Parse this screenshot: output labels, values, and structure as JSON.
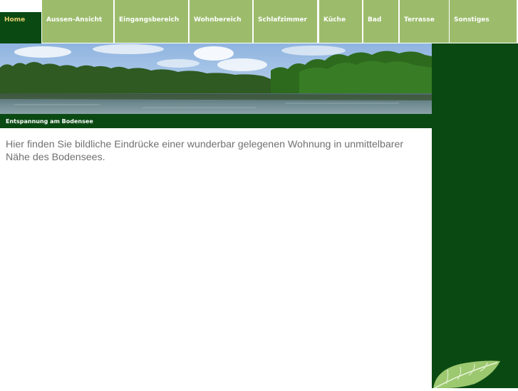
{
  "nav": {
    "items": [
      {
        "label": "Home"
      },
      {
        "label": "Aussen-Ansicht"
      },
      {
        "label": "Eingangsbereich"
      },
      {
        "label": "Wohnbereich"
      },
      {
        "label": "Schlafzimmer"
      },
      {
        "label": "Küche"
      },
      {
        "label": "Bad"
      },
      {
        "label": "Terrasse"
      },
      {
        "label": "Sonstiges"
      }
    ],
    "active": "Home"
  },
  "banner": {
    "caption": "Entspannung am Bodensee"
  },
  "main": {
    "text": "Hier finden Sie bildliche Eindrücke einer wunderbar gelegenen Wohnung in unmittelbarer Nähe des Bodensees."
  },
  "colors": {
    "nav_green": "#9cbc6c",
    "dark_green": "#0a4a12",
    "active_text": "#e8d070",
    "body_text": "#707070"
  }
}
